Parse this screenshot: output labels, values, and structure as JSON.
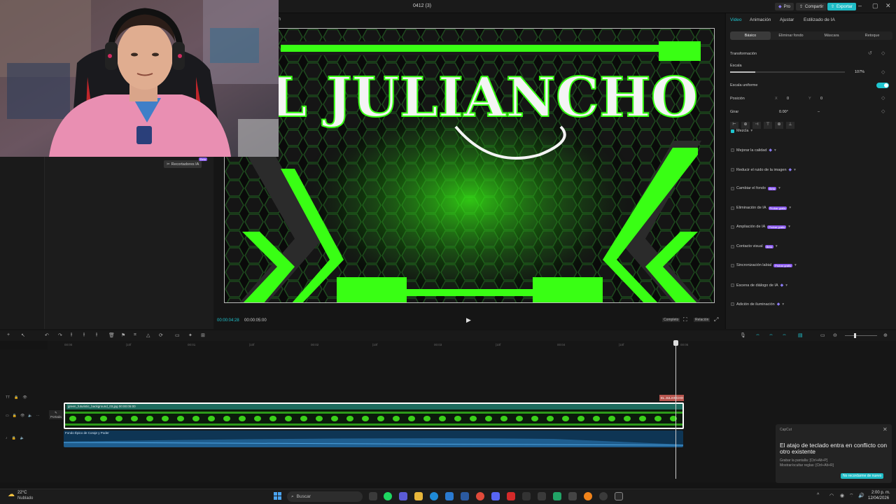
{
  "app": {
    "project_title": "0412 (3)",
    "top_buttons": {
      "pro": "Pro",
      "share": "Compartir",
      "export": "Exportar"
    }
  },
  "media_panel": {
    "cutter_label": "Recortadores IA",
    "new_badge": "Beta"
  },
  "player": {
    "panel_title": "n",
    "current_time": "00:00:04:28",
    "total_time": "00:00:05:00",
    "full_label": "Completo",
    "ratio_label": "Relación",
    "artwork_text": "EL JULIANCHO"
  },
  "inspector": {
    "tabs": [
      "Video",
      "Animación",
      "Ajustar",
      "Estilizado de IA"
    ],
    "subtabs": [
      "Básico",
      "Eliminar fondo",
      "Máscara",
      "Retoque"
    ],
    "transform_label": "Transformación",
    "scale_label": "Escala",
    "scale_value": "107%",
    "scale_fraction": 0.22,
    "uniform_scale_label": "Escala uniforme",
    "position_label": "Posición",
    "pos_x_label": "X",
    "pos_x_value": "0",
    "pos_y_label": "Y",
    "pos_y_value": "0",
    "rotate_label": "Girar",
    "rotate_value": "0.00°",
    "rotate_dash": "–",
    "options": [
      {
        "label": "Mezcla",
        "checked": true,
        "badge": ""
      },
      {
        "label": "Mejorar la calidad",
        "checked": false,
        "badge": ""
      },
      {
        "label": "Reducir el ruido de la imagen",
        "checked": false,
        "badge": ""
      },
      {
        "label": "Cambiar el fondo",
        "checked": false,
        "badge": "Beta"
      },
      {
        "label": "Eliminación de IA",
        "checked": false,
        "badge": "Probar gratis"
      },
      {
        "label": "Ampliación de IA",
        "checked": false,
        "badge": "Probar gratis"
      },
      {
        "label": "Contacto visual",
        "checked": false,
        "badge": "Beta"
      },
      {
        "label": "Sincronización labial",
        "checked": false,
        "badge": "Probar gratis"
      },
      {
        "label": "Escena de diálogo de IA",
        "checked": false,
        "badge": ""
      },
      {
        "label": "Adición de iluminación",
        "checked": false,
        "badge": ""
      }
    ]
  },
  "timeline": {
    "ruler_ticks": [
      "00:00",
      "|10f",
      "00:01",
      "|10f",
      "00:02",
      "|10f",
      "00:03",
      "|10f",
      "00:04",
      "|10f",
      "00:05"
    ],
    "cover_label": "Portada",
    "text_clip_label": "EL JULIANCHO",
    "video_clip_label": "green_futuristic_background_03.jpg   00:00:05:00",
    "audio_clip_label": "Fondo Épico de Coraje y Poder"
  },
  "notification": {
    "app_name": "CapCut",
    "title": "El atajo de teclado entra en conflicto con otro existente",
    "line1": "Grabar la pantalla: [Ctrl+Alt+P]",
    "line2": "Mostrar/ocultar reglas: [Ctrl+Alt+R]",
    "button": "No recordarme de nuevo"
  },
  "taskbar": {
    "weather_temp": "22°C",
    "weather_desc": "Nublado",
    "search_placeholder": "Buscar",
    "time": "2:00 p. m.",
    "date": "12/04/2026"
  },
  "colors": {
    "accent": "#1fc6d0",
    "brand_purple": "#8c5cf0",
    "green_glow": "#39ff14"
  }
}
